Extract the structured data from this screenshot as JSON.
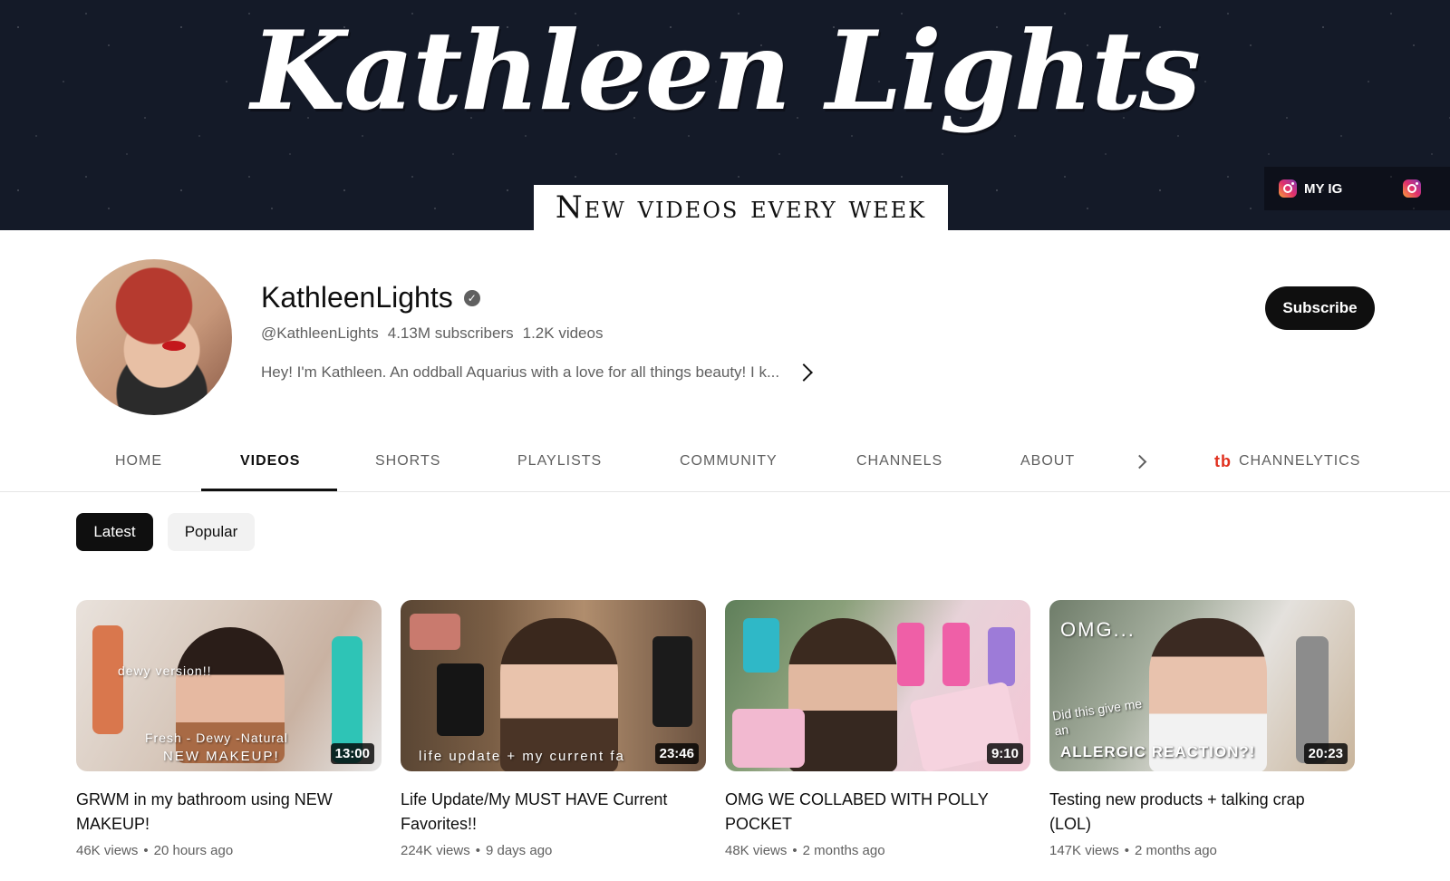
{
  "banner": {
    "logo_text": "Kathleen Lights",
    "tagline": "New videos every week",
    "link_label": "MY IG"
  },
  "channel": {
    "name": "KathleenLights",
    "handle": "@KathleenLights",
    "subscribers": "4.13M subscribers",
    "video_count": "1.2K videos",
    "description": "Hey! I'm Kathleen. An oddball Aquarius with a love for all things beauty! I k...",
    "subscribe_label": "Subscribe"
  },
  "tabs": [
    {
      "label": "HOME"
    },
    {
      "label": "VIDEOS"
    },
    {
      "label": "SHORTS"
    },
    {
      "label": "PLAYLISTS"
    },
    {
      "label": "COMMUNITY"
    },
    {
      "label": "CHANNELS"
    },
    {
      "label": "ABOUT"
    }
  ],
  "extension_tab": {
    "label": "CHANNELYTICS",
    "icon": "tb"
  },
  "chips": [
    {
      "label": "Latest",
      "selected": true
    },
    {
      "label": "Popular",
      "selected": false
    }
  ],
  "videos": [
    {
      "title": "GRWM in my bathroom using NEW MAKEUP!",
      "views": "46K views",
      "age": "20 hours ago",
      "duration": "13:00",
      "thumb_text_1": "Fresh - Dewy -Natural",
      "thumb_text_2": "NEW MAKEUP!",
      "thumb_text_3": "dewy version!!"
    },
    {
      "title": "Life Update/My MUST HAVE Current Favorites!!",
      "views": "224K views",
      "age": "9 days ago",
      "duration": "23:46",
      "thumb_text_1": "life update + my current fa"
    },
    {
      "title": "OMG WE COLLABED WITH POLLY POCKET",
      "views": "48K views",
      "age": "2 months ago",
      "duration": "9:10"
    },
    {
      "title": "Testing new products + talking crap (LOL)",
      "views": "147K views",
      "age": "2 months ago",
      "duration": "20:23",
      "thumb_text_1": "OMG...",
      "thumb_text_2": "Did this give me an",
      "thumb_text_3": "ALLERGIC REACTION?!"
    }
  ]
}
